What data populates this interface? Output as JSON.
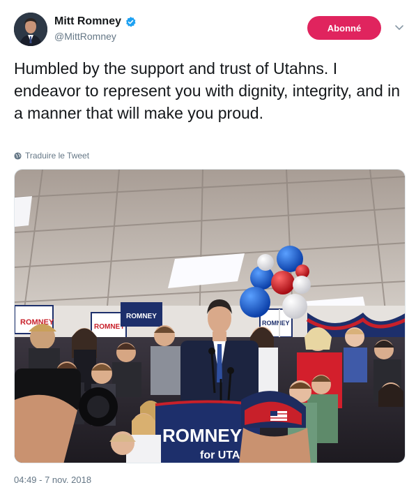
{
  "author": {
    "display_name": "Mitt Romney",
    "handle": "@MittRomney",
    "verified_icon": "verified-badge-icon",
    "verified_color": "#1da1f2"
  },
  "follow_button": {
    "label": "Abonné",
    "color": "#e0245e"
  },
  "tweet": {
    "text": "Humbled by the support and trust of Utahns. I endeavor to represent you with dignity, integrity, and in a manner that will make you proud.",
    "translate_label": "Traduire le Tweet",
    "timestamp": "04:49 - 7 nov. 2018"
  },
  "media": {
    "podium_sign": {
      "line1": "ROMNEY",
      "line2": "for UTAH"
    },
    "side_signs": [
      "ROMNEY",
      "ROMNEY",
      "ROMNEY",
      "ROMNEY"
    ]
  }
}
